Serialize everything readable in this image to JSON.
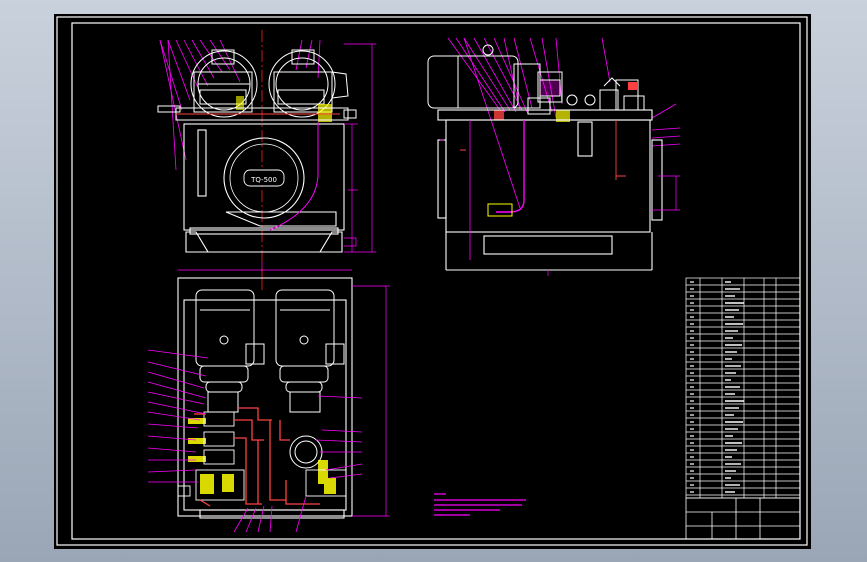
{
  "viewport": {
    "background": "#000000",
    "frame_color": "#ffffff"
  },
  "drawing": {
    "nameplate_text": "TQ-500",
    "colors": {
      "outline": "#ffffff",
      "leader": "#ff00ff",
      "centerline": "#ff2020",
      "dimension": "#ff00ff",
      "piping": "#ff4040",
      "valve": "#ffff00",
      "notes": "#ff00ff",
      "table": "#ffffff"
    }
  }
}
